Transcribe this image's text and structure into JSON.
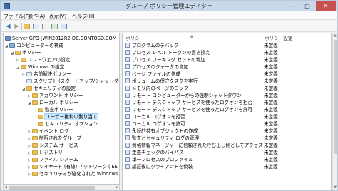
{
  "window": {
    "title": "グループ ポリシー管理エディター",
    "min_glyph": "—",
    "max_glyph": "□",
    "close_glyph": "✕"
  },
  "menu": [
    "ファイル(F)",
    "操作(A)",
    "表示(V)",
    "ヘルプ(H)"
  ],
  "toolbar": {
    "back_glyph": "◀",
    "forward_glyph": "▶",
    "buttons": [
      "folder-icon",
      "properties-icon",
      "refresh-icon",
      "export-icon",
      "help-icon"
    ]
  },
  "tree": [
    {
      "label": "Server GPO [WIN2012R2-DC.CONTOSO.COM",
      "icon": "gpo",
      "exp": ""
    },
    {
      "label": "コンピューターの構成",
      "icon": "comp",
      "exp": "◢"
    },
    {
      "label": "ポリシー",
      "icon": "folder",
      "exp": "◢"
    },
    {
      "label": "ソフトウェアの設定",
      "icon": "folder",
      "exp": "▷"
    },
    {
      "label": "Windows の設定",
      "icon": "folder",
      "exp": "◢"
    },
    {
      "label": "名前解決ポリシー",
      "icon": "doc",
      "exp": "▷"
    },
    {
      "label": "スクリプト (スタートアップ/シャットダウン)",
      "icon": "doc",
      "exp": ""
    },
    {
      "label": "セキュリティの設定",
      "icon": "folder",
      "exp": "◢"
    },
    {
      "label": "アカウント ポリシー",
      "icon": "folder",
      "exp": "▷"
    },
    {
      "label": "ローカル ポリシー",
      "icon": "folder",
      "exp": "◢"
    },
    {
      "label": "監査ポリシー",
      "icon": "folder",
      "exp": ""
    },
    {
      "label": "ユーザー権利の割り当て",
      "icon": "folder",
      "exp": "",
      "selected": true
    },
    {
      "label": "セキュリティ オプション",
      "icon": "folder",
      "exp": ""
    },
    {
      "label": "イベント ログ",
      "icon": "folder",
      "exp": "▷"
    },
    {
      "label": "制限されたグループ",
      "icon": "folder",
      "exp": "▷"
    },
    {
      "label": "システム サービス",
      "icon": "folder",
      "exp": "▷"
    },
    {
      "label": "レジストリ",
      "icon": "folder",
      "exp": "▷"
    },
    {
      "label": "ファイル システム",
      "icon": "folder",
      "exp": "▷"
    },
    {
      "label": "ワイヤード (有線) ネットワーク (IEE",
      "icon": "folder",
      "exp": "▷"
    },
    {
      "label": "セキュリティが強化された Windows",
      "icon": "folder",
      "exp": "▷"
    }
  ],
  "list": {
    "col_policy": "ポリシー",
    "col_setting": "ポリシー設定",
    "sort_glyph": "▲",
    "rows": [
      {
        "policy": "プログラムのデバッグ",
        "setting": "未定義"
      },
      {
        "policy": "プロセス レベル トークンの置き換え",
        "setting": "未定義"
      },
      {
        "policy": "プロセス ワーキング セットの増加",
        "setting": "未定義"
      },
      {
        "policy": "プロセスのクォータの増加",
        "setting": "未定義"
      },
      {
        "policy": "ページ ファイルの作成",
        "setting": "未定義"
      },
      {
        "policy": "ボリュームの保守タスクを実行",
        "setting": "未定義"
      },
      {
        "policy": "メモリ内のページのロック",
        "setting": "未定義"
      },
      {
        "policy": "リモート コンピューターからの強制シャットダウン",
        "setting": "未定義"
      },
      {
        "policy": "リモート デスクトップ サービスを使ったログオンを拒否",
        "setting": "未定義"
      },
      {
        "policy": "リモート デスクトップ サービスを使ったログオンを許可",
        "setting": "未定義"
      },
      {
        "policy": "ローカル ログオンを拒否",
        "setting": "未定義"
      },
      {
        "policy": "ローカル ログオンを許可",
        "setting": "未定義"
      },
      {
        "policy": "永続的共有オブジェクトの作成",
        "setting": "未定義"
      },
      {
        "policy": "監査とセキュリティ ログの管理",
        "setting": "未定義"
      },
      {
        "policy": "資格情報マネージャーに信頼された呼び出し側としてアクセス",
        "setting": "未定義"
      },
      {
        "policy": "走査チェックのバイパス",
        "setting": "未定義"
      },
      {
        "policy": "単一プロセスのプロファイル",
        "setting": "未定義"
      },
      {
        "policy": "認証後にクライアントを偽装",
        "setting": "未定義"
      }
    ]
  }
}
